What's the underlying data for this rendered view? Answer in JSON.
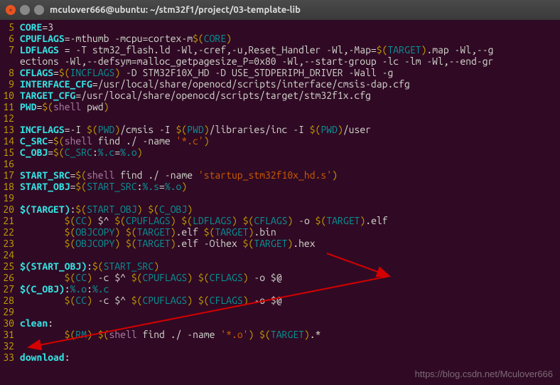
{
  "window": {
    "title": "mculover666@ubuntu: ~/stm32f1/project/03-template-lib"
  },
  "lines": {
    "l5": {
      "no": "5",
      "a": "CORE",
      "b": "=3"
    },
    "l6": {
      "no": "6",
      "a": "CPUFLAGS",
      "b": "=-mthumb -mcpu=cortex-m",
      "c": "$(",
      "d": "CORE",
      "e": ")"
    },
    "l7": {
      "no": "7",
      "a": "LDFLAGS",
      "b": " = -T stm32_flash.ld -Wl,-cref,-u,Reset_Handler -Wl,-Map=",
      "c": "$(",
      "d": "TARGET",
      "e": ")",
      "f": ".map -Wl,--g"
    },
    "l7b": {
      "no": " ",
      "a": "ections -Wl,--defsym=malloc_getpagesize_P=0x80 -Wl,--start-group -lc -lm -Wl,--end-gr"
    },
    "l8": {
      "no": "8",
      "a": "CFLAGS",
      "b": "=",
      "c": "$(",
      "d": "INCFLAGS",
      "e": ")",
      "f": " -D STM32F10X_HD -D USE_STDPERIPH_DRIVER -Wall -g"
    },
    "l9": {
      "no": "9",
      "a": "INTERFACE_CFG",
      "b": "=/usr/local/share/openocd/scripts/interface/cmsis-dap.cfg"
    },
    "l10": {
      "no": "10",
      "a": "TARGET_CFG",
      "b": "=/usr/local/share/openocd/scripts/target/stm32f1x.cfg"
    },
    "l11": {
      "no": "11",
      "a": "PWD",
      "b": "=",
      "c": "$(",
      "d": "shell",
      "e": " pwd",
      "f": ")"
    },
    "l12": {
      "no": "12"
    },
    "l13": {
      "no": "13",
      "a": "INCFLAGS",
      "b": "=-I ",
      "c": "$(",
      "d": "PWD",
      "e": ")",
      "f": "/cmsis -I ",
      "g": "$(",
      "h": "PWD",
      "i": ")",
      "j": "/libraries/inc -I ",
      "k": "$(",
      "l": "PWD",
      "m": ")",
      "n": "/user"
    },
    "l14": {
      "no": "14",
      "a": "C_SRC",
      "b": "=",
      "c": "$(",
      "d": "shell",
      "e": " find ./ -name ",
      "f": "'*.c'",
      "g": ")"
    },
    "l15": {
      "no": "15",
      "a": "C_OBJ",
      "b": "=",
      "c": "$(",
      "d": "C_SRC",
      "e": ":",
      "f": "%.c",
      "g": "=",
      "h": "%.o",
      "i": ")"
    },
    "l16": {
      "no": "16"
    },
    "l17": {
      "no": "17",
      "a": "START_SRC",
      "b": "=",
      "c": "$(",
      "d": "shell",
      "e": " find ./ -name ",
      "f": "'startup_stm32f10x_hd.s'",
      "g": ")"
    },
    "l18": {
      "no": "18",
      "a": "START_OBJ",
      "b": "=",
      "c": "$(",
      "d": "START_SRC",
      "e": ":",
      "f": "%.s",
      "g": "=",
      "h": "%.o",
      "i": ")"
    },
    "l19": {
      "no": "19"
    },
    "l20": {
      "no": "20",
      "a": "$(TARGET)",
      "b": ":",
      "c": "$(",
      "d": "START_OBJ",
      "e": ") $(",
      "f": "C_OBJ",
      "g": ")"
    },
    "l21": {
      "no": "21",
      "ind": "        ",
      "a": "$(",
      "b": "CC",
      "c": ")",
      "d": " $^ ",
      "e": "$(",
      "f": "CPUFLAGS",
      "g": ") $(",
      "h": "LDFLAGS",
      "i": ") $(",
      "j": "CFLAGS",
      "k": ")",
      "l": " -o ",
      "m": "$(",
      "n": "TARGET",
      "o": ")",
      "p": ".elf"
    },
    "l22": {
      "no": "22",
      "ind": "        ",
      "a": "$(",
      "b": "OBJCOPY",
      "c": ") $(",
      "d": "TARGET",
      "e": ")",
      "f": ".elf ",
      "g": "$(",
      "h": "TARGET",
      "i": ")",
      "j": ".bin"
    },
    "l23": {
      "no": "23",
      "ind": "        ",
      "a": "$(",
      "b": "OBJCOPY",
      "c": ") $(",
      "d": "TARGET",
      "e": ")",
      "f": ".elf -Oihex ",
      "g": "$(",
      "h": "TARGET",
      "i": ")",
      "j": ".hex"
    },
    "l24": {
      "no": "24"
    },
    "l25": {
      "no": "25",
      "a": "$(START_OBJ)",
      "b": ":",
      "c": "$(",
      "d": "START_SRC",
      "e": ")"
    },
    "l26": {
      "no": "26",
      "ind": "        ",
      "a": "$(",
      "b": "CC",
      "c": ")",
      "d": " -c $^ ",
      "e": "$(",
      "f": "CPUFLAGS",
      "g": ") $(",
      "h": "CFLAGS",
      "i": ")",
      "j": " -o $@"
    },
    "l27": {
      "no": "27",
      "a": "$(C_OBJ)",
      "b": ":",
      "c": "%.o",
      "d": ":",
      "e": "%.c"
    },
    "l28": {
      "no": "28",
      "ind": "        ",
      "a": "$(",
      "b": "CC",
      "c": ")",
      "d": " -c $^ ",
      "e": "$(",
      "f": "CPUFLAGS",
      "g": ") $(",
      "h": "CFLAGS",
      "i": ")",
      "j": " -o $@"
    },
    "l29": {
      "no": "29"
    },
    "l30": {
      "no": "30",
      "a": "clean",
      "b": ":"
    },
    "l31": {
      "no": "31",
      "ind": "        ",
      "a": "$(",
      "b": "RM",
      "c": ") $(",
      "d": "shell",
      "e": " find ./ -name ",
      "f": "'*.o'",
      "g": ") $(",
      "h": "TARGET",
      "i": ")",
      "j": ".*"
    },
    "l32": {
      "no": "32"
    },
    "l33": {
      "no": "33",
      "a": "download",
      "b": ":"
    }
  },
  "watermark": "https://blog.csdn.net/Mculover666"
}
